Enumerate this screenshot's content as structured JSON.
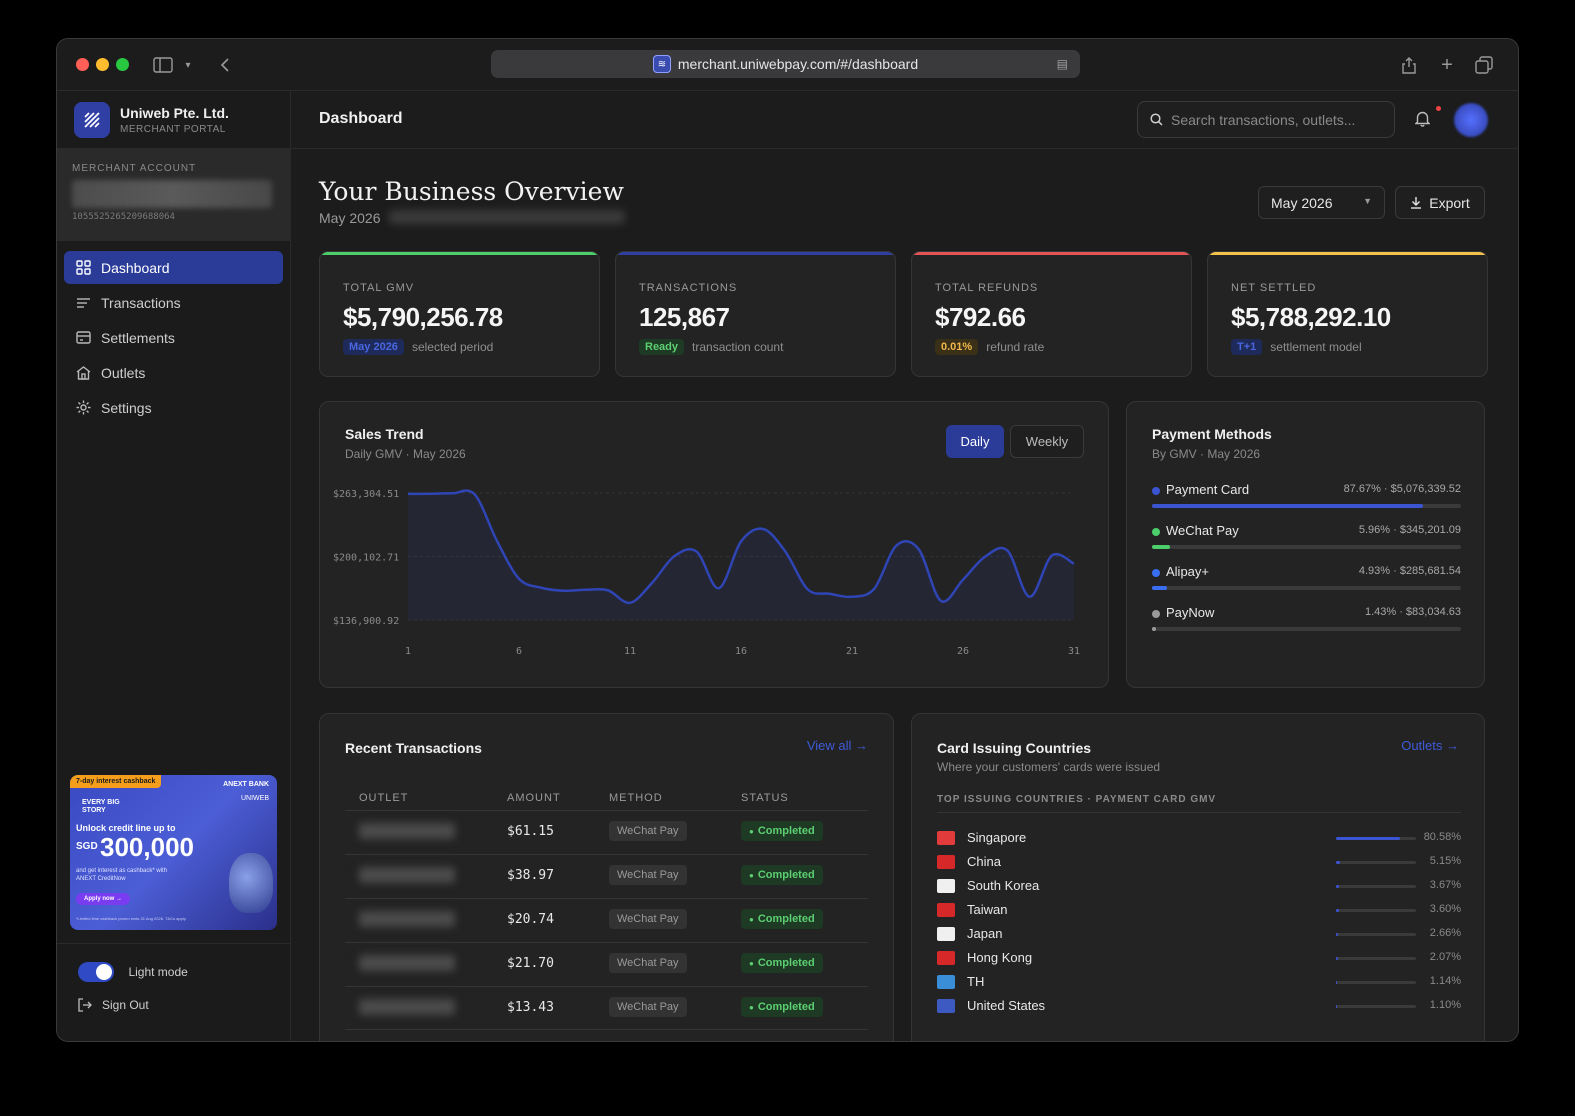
{
  "browser": {
    "url": "merchant.uniwebpay.com/#/dashboard"
  },
  "brand": {
    "name": "Uniweb Pte. Ltd.",
    "subtitle": "MERCHANT PORTAL"
  },
  "account": {
    "label": "MERCHANT ACCOUNT",
    "id": "1055525265209688064"
  },
  "nav": [
    {
      "label": "Dashboard",
      "icon": "grid-icon",
      "active": true
    },
    {
      "label": "Transactions",
      "icon": "list-icon",
      "active": false
    },
    {
      "label": "Settlements",
      "icon": "wallet-icon",
      "active": false
    },
    {
      "label": "Outlets",
      "icon": "store-icon",
      "active": false
    },
    {
      "label": "Settings",
      "icon": "gear-icon",
      "active": false
    }
  ],
  "promo": {
    "tag": "7-day interest cashback",
    "bank": "ANEXT BANK",
    "partner": "UNIWEB",
    "story": "EVERY BIG STORY",
    "headline": "Unlock credit line up to",
    "currency": "SGD",
    "amount": "300,000",
    "sub": "and get interest as cashback* with ANEXT CreditNow",
    "cta": "Apply now →",
    "fine": "*Limited time cashback promo ends 31 Aug 2026. T&Cs apply."
  },
  "footer": {
    "mode_label": "Light mode",
    "signout": "Sign Out"
  },
  "topbar": {
    "title": "Dashboard",
    "search_placeholder": "Search transactions, outlets..."
  },
  "hero": {
    "title": "Your Business Overview",
    "subtitle": "May 2026",
    "period": "May 2026",
    "export": "Export"
  },
  "kpis": [
    {
      "label": "TOTAL GMV",
      "value": "$5,790,256.78",
      "chip": "May 2026",
      "note": "selected period",
      "accent": "#4ccf6a",
      "chip_bg": "#1e2a5a",
      "chip_color": "#4a67e0"
    },
    {
      "label": "TRANSACTIONS",
      "value": "125,867",
      "chip": "Ready",
      "note": "transaction count",
      "accent": "#2f3fa4",
      "chip_bg": "#1e3a24",
      "chip_color": "#5ccf72"
    },
    {
      "label": "TOTAL REFUNDS",
      "value": "$792.66",
      "chip": "0.01%",
      "note": "refund rate",
      "accent": "#e25555",
      "chip_bg": "#3a3018",
      "chip_color": "#f2b84b"
    },
    {
      "label": "NET SETTLED",
      "value": "$5,788,292.10",
      "chip": "T+1",
      "note": "settlement model",
      "accent": "#f2c24b",
      "chip_bg": "#1e2a5a",
      "chip_color": "#4a67e0"
    }
  ],
  "sales": {
    "title": "Sales Trend",
    "subtitle": "Daily GMV · May 2026",
    "tabs": [
      "Daily",
      "Weekly"
    ],
    "active_tab": "Daily"
  },
  "chart_data": {
    "type": "line",
    "title": "Sales Trend",
    "subtitle": "Daily GMV · May 2026",
    "x": [
      1,
      2,
      3,
      4,
      5,
      6,
      7,
      8,
      9,
      10,
      11,
      12,
      13,
      14,
      15,
      16,
      17,
      18,
      19,
      20,
      21,
      22,
      23,
      24,
      25,
      26,
      27,
      28,
      29,
      30,
      31
    ],
    "series": [
      {
        "values": [
          262500,
          262500,
          263000,
          262000,
          216000,
          178000,
          169000,
          166000,
          167000,
          166500,
          154000,
          174000,
          200500,
          205000,
          168500,
          215000,
          227500,
          205000,
          167500,
          163000,
          160000,
          168000,
          211000,
          207500,
          156000,
          177000,
          200000,
          206000,
          160000,
          201000,
          193000
        ]
      }
    ],
    "yticks": [
      "$263,304.51",
      "$200,102.71",
      "$136,900.92"
    ],
    "xticks": [
      "1",
      "6",
      "11",
      "16",
      "21",
      "26",
      "31"
    ],
    "ylim": [
      136900.92,
      263304.51
    ],
    "color": "#2f45b5"
  },
  "payment_methods": {
    "title": "Payment Methods",
    "subtitle": "By GMV · May 2026",
    "items": [
      {
        "name": "Payment Card",
        "value": "87.67% · $5,076,339.52",
        "pct": 87.67,
        "color": "#3a54d2"
      },
      {
        "name": "WeChat Pay",
        "value": "5.96% · $345,201.09",
        "pct": 5.96,
        "color": "#4ccf6a"
      },
      {
        "name": "Alipay+",
        "value": "4.93% · $285,681.54",
        "pct": 4.93,
        "color": "#3a6ef0"
      },
      {
        "name": "PayNow",
        "value": "1.43% · $83,034.63",
        "pct": 1.43,
        "color": "#9a9a9a"
      }
    ]
  },
  "recent": {
    "title": "Recent Transactions",
    "view_all": "View all →",
    "columns": [
      "OUTLET",
      "AMOUNT",
      "METHOD",
      "STATUS"
    ],
    "rows": [
      {
        "amount": "$61.15",
        "method": "WeChat Pay",
        "status": "Completed"
      },
      {
        "amount": "$38.97",
        "method": "WeChat Pay",
        "status": "Completed"
      },
      {
        "amount": "$20.74",
        "method": "WeChat Pay",
        "status": "Completed"
      },
      {
        "amount": "$21.70",
        "method": "WeChat Pay",
        "status": "Completed"
      },
      {
        "amount": "$13.43",
        "method": "WeChat Pay",
        "status": "Completed"
      }
    ]
  },
  "countries": {
    "title": "Card Issuing Countries",
    "subtitle": "Where your customers' cards were issued",
    "link": "Outlets →",
    "section": "TOP ISSUING COUNTRIES · PAYMENT CARD GMV",
    "items": [
      {
        "name": "Singapore",
        "pct_label": "80.58%",
        "pct": 80.58,
        "flag": "#e23b3b"
      },
      {
        "name": "China",
        "pct_label": "5.15%",
        "pct": 5.15,
        "flag": "#d62828"
      },
      {
        "name": "South Korea",
        "pct_label": "3.67%",
        "pct": 3.67,
        "flag": "#f0f0f0"
      },
      {
        "name": "Taiwan",
        "pct_label": "3.60%",
        "pct": 3.6,
        "flag": "#d62828"
      },
      {
        "name": "Japan",
        "pct_label": "2.66%",
        "pct": 2.66,
        "flag": "#f0f0f0"
      },
      {
        "name": "Hong Kong",
        "pct_label": "2.07%",
        "pct": 2.07,
        "flag": "#d62828"
      },
      {
        "name": "TH",
        "pct_label": "1.14%",
        "pct": 1.14,
        "flag": "#3a8ed8"
      },
      {
        "name": "United States",
        "pct_label": "1.10%",
        "pct": 1.1,
        "flag": "#3c5ac2"
      }
    ]
  }
}
